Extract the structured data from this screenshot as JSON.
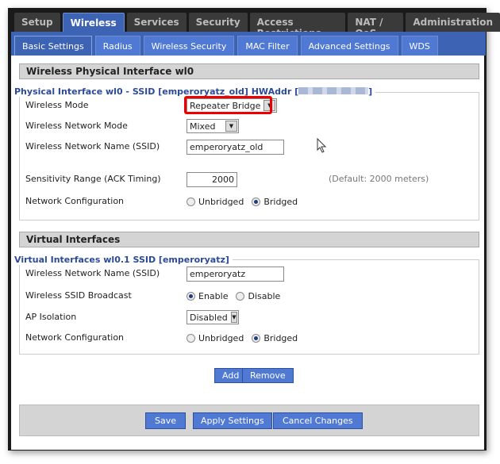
{
  "main_tabs": [
    "Setup",
    "Wireless",
    "Services",
    "Security",
    "Access Restrictions",
    "NAT / QoS",
    "Administration"
  ],
  "active_main_tab": "Wireless",
  "sub_tabs": [
    "Basic Settings",
    "Radius",
    "Wireless Security",
    "MAC Filter",
    "Advanced Settings",
    "WDS"
  ],
  "physical": {
    "section_title": "Wireless Physical Interface wl0",
    "legend_prefix": "Physical Interface wl0 - SSID [emperoryatz_old] HWAddr [",
    "legend_suffix": "]",
    "wireless_mode_label": "Wireless Mode",
    "wireless_mode_value": "Repeater Bridge",
    "network_mode_label": "Wireless Network Mode",
    "network_mode_value": "Mixed",
    "ssid_label": "Wireless Network Name (SSID)",
    "ssid_value": "emperoryatz_old",
    "ack_label": "Sensitivity Range (ACK Timing)",
    "ack_value": "2000",
    "ack_hint": "(Default: 2000 meters)",
    "netconf_label": "Network Configuration",
    "unbridged": "Unbridged",
    "bridged": "Bridged"
  },
  "virtual": {
    "section_title": "Virtual Interfaces",
    "legend": "Virtual Interfaces wl0.1 SSID [emperoryatz]",
    "ssid_label": "Wireless Network Name (SSID)",
    "ssid_value": "emperoryatz",
    "broadcast_label": "Wireless SSID Broadcast",
    "enable": "Enable",
    "disable": "Disable",
    "isolation_label": "AP Isolation",
    "isolation_value": "Disabled",
    "netconf_label": "Network Configuration",
    "unbridged": "Unbridged",
    "bridged": "Bridged",
    "add": "Add",
    "remove": "Remove"
  },
  "footer": {
    "save": "Save",
    "apply": "Apply Settings",
    "cancel": "Cancel Changes"
  }
}
